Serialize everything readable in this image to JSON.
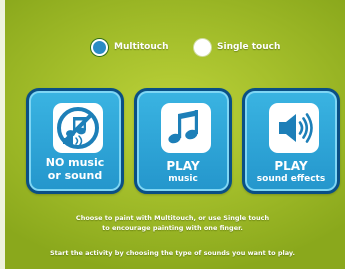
{
  "mode_selector": {
    "multitouch": {
      "label": "Multitouch",
      "selected": true
    },
    "single_touch": {
      "label": "Single touch",
      "selected": false
    }
  },
  "sound_options": [
    {
      "title": "NO music",
      "subtitle": "or sound",
      "icon": "no-music-icon"
    },
    {
      "title": "PLAY",
      "subtitle": "music",
      "icon": "music-note-icon"
    },
    {
      "title": "PLAY",
      "subtitle": "sound effects",
      "icon": "speaker-icon"
    }
  ],
  "instructions": {
    "line1": "Choose to paint with Multitouch, or use Single touch",
    "line2": "to encourage painting with one finger.",
    "line3": "Start the activity by choosing the type of sounds you want to play."
  },
  "colors": {
    "background": "#a6c02c",
    "card_fill": "#2496cc",
    "card_border": "#0a4f85",
    "card_highlight": "#7fd6f4",
    "icon_blue": "#1d7fb8",
    "selected_radio": "#2b8bc4",
    "text": "#ffffff"
  }
}
